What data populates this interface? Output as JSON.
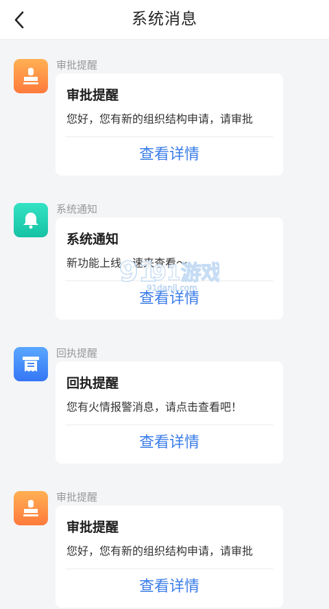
{
  "header": {
    "title": "系统消息",
    "back_icon": "chevron-left-icon"
  },
  "messages": [
    {
      "category": "审批提醒",
      "title": "审批提醒",
      "body": "您好，您有新的组织结构申请，请审批",
      "action": "查看详情",
      "icon": "stamp-icon",
      "color": "#ff8c42"
    },
    {
      "category": "系统通知",
      "title": "系统通知",
      "body": "新功能上线，速来查看～",
      "action": "查看详情",
      "icon": "bell-icon",
      "color": "#1fcfb1"
    },
    {
      "category": "回执提醒",
      "title": "回执提醒",
      "body": "您有火情报警消息，请点击查看吧！",
      "action": "查看详情",
      "icon": "receipt-icon",
      "color": "#4a8af7"
    },
    {
      "category": "审批提醒",
      "title": "审批提醒",
      "body": "您好，您有新的组织结构申请，请审批",
      "action": "查看详情",
      "icon": "stamp-icon",
      "color": "#ff8c42"
    }
  ],
  "watermark": {
    "brand": "91游戏",
    "site": "91danji.com"
  }
}
